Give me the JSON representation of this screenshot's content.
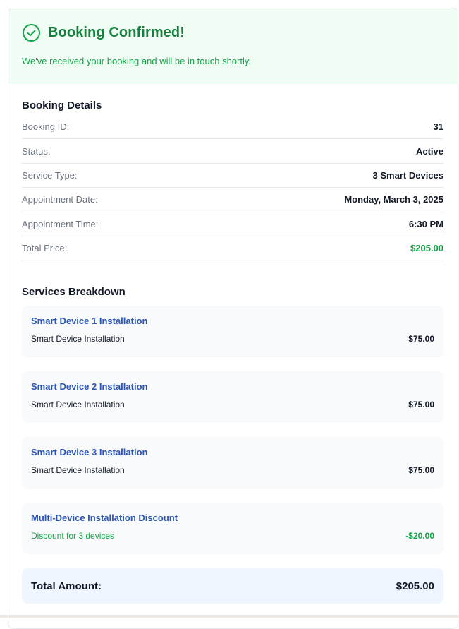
{
  "banner": {
    "title": "Booking Confirmed!",
    "message": "We've received your booking and will be in touch shortly.",
    "icon": "check-circle-icon"
  },
  "details": {
    "title": "Booking Details",
    "rows": [
      {
        "label": "Booking ID:",
        "value": "31"
      },
      {
        "label": "Status:",
        "value": "Active"
      },
      {
        "label": "Service Type:",
        "value": "3 Smart Devices"
      },
      {
        "label": "Appointment Date:",
        "value": "Monday, March 3, 2025"
      },
      {
        "label": "Appointment Time:",
        "value": "6:30 PM"
      },
      {
        "label": "Total Price:",
        "value": "$205.00"
      }
    ]
  },
  "services": {
    "title": "Services Breakdown",
    "items": [
      {
        "name": "Smart Device 1 Installation",
        "description": "Smart Device Installation",
        "amount": "$75.00"
      },
      {
        "name": "Smart Device 2 Installation",
        "description": "Smart Device Installation",
        "amount": "$75.00"
      },
      {
        "name": "Smart Device 3 Installation",
        "description": "Smart Device Installation",
        "amount": "$75.00"
      },
      {
        "name": "Multi-Device Installation Discount",
        "description": "Discount for 3 devices",
        "amount": "-$20.00"
      }
    ]
  },
  "total": {
    "label": "Total Amount:",
    "value": "$205.00"
  },
  "colors": {
    "success": "#16a34a",
    "success_dark": "#15803d",
    "link_blue": "#2c55b8",
    "total_bg": "#eff6ff"
  }
}
